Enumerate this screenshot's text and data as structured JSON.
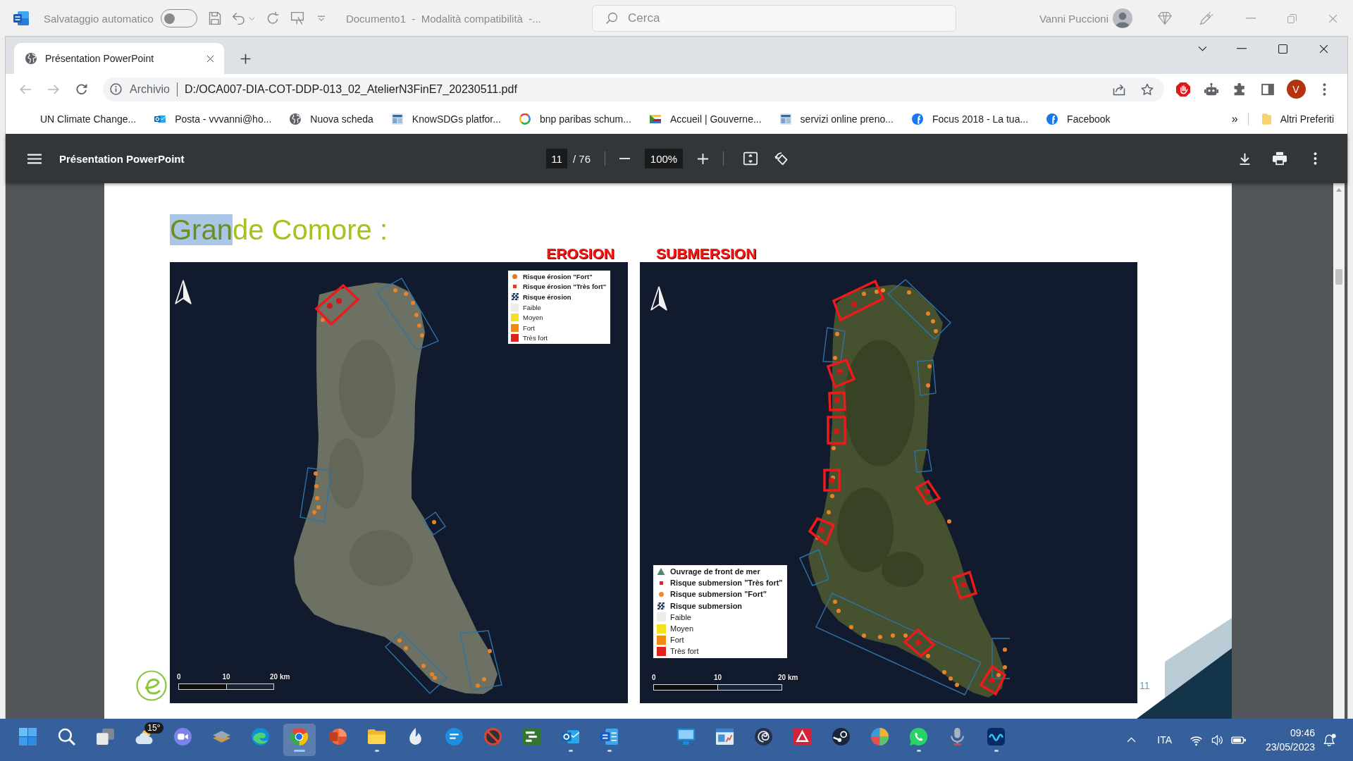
{
  "word_window": {
    "autosave_label": "Salvataggio automatico",
    "autosave_on": false,
    "document_title": "Documento1  -  Modalità compatibilità  -...",
    "search": {
      "placeholder": "Cerca"
    },
    "user_name": "Vanni Puccioni"
  },
  "browser": {
    "tabs": [
      {
        "title": "Présentation PowerPoint",
        "selected": true
      }
    ],
    "address_bar": {
      "scheme": "Archivio",
      "url": "D:/OCA007-DIA-COT-DDP-013_02_AtelierN3FinE7_20230511.pdf"
    },
    "profile_initial": "V",
    "bookmarks": [
      "UN Climate Change...",
      "Posta - vvvanni@ho...",
      "Nuova scheda",
      "KnowSDGs platfor...",
      "bnp paribas schum...",
      "Accueil | Gouverne...",
      "servizi online preno...",
      "Focus 2018 - La tua...",
      "Facebook"
    ],
    "more_bookmarks": "»",
    "other_bookmarks": "Altri Preferiti"
  },
  "pdf_viewer": {
    "title": "Présentation PowerPoint",
    "page": "11",
    "page_total": "/ 76",
    "zoom": "100%"
  },
  "slide": {
    "title": [
      {
        "text": "Gran",
        "highlighted": true
      },
      {
        "text": "de Comore :",
        "highlighted": false
      }
    ],
    "maps": [
      {
        "title": "EROSION",
        "legend": [
          {
            "kind": "dot",
            "label": "Risque érosion \"Fort\"",
            "color": "#e07b25"
          },
          {
            "kind": "small-dot",
            "label": "Risque érosion \"Très fort\"",
            "color": "#d9412a"
          },
          {
            "kind": "raster",
            "label": "Risque érosion"
          },
          {
            "kind": "swatch",
            "label": "Faible",
            "color": "#ececec"
          },
          {
            "kind": "swatch",
            "label": "Moyen",
            "color": "#f5e11b"
          },
          {
            "kind": "swatch",
            "label": "Fort",
            "color": "#f08a10"
          },
          {
            "kind": "swatch",
            "label": "Très fort",
            "color": "#e3211c"
          }
        ],
        "scale": [
          "0",
          "10",
          "20 km"
        ]
      },
      {
        "title": "SUBMERSION",
        "legend": [
          {
            "kind": "triangle",
            "label": "Ouvrage de front de mer",
            "color": "#4f8a64"
          },
          {
            "kind": "small-dot",
            "label": "Risque submersion \"Très fort\"",
            "color": "#e0242a"
          },
          {
            "kind": "dot",
            "label": "Risque submersion \"Fort\"",
            "color": "#f08a24"
          },
          {
            "kind": "raster",
            "label": "Risque submersion"
          },
          {
            "kind": "swatch",
            "label": "Faible",
            "color": "#ececec"
          },
          {
            "kind": "swatch",
            "label": "Moyen",
            "color": "#f5e11b"
          },
          {
            "kind": "swatch",
            "label": "Fort",
            "color": "#f08a10"
          },
          {
            "kind": "swatch",
            "label": "Très fort",
            "color": "#e3211c"
          }
        ],
        "scale": [
          "0",
          "10",
          "20 km"
        ]
      }
    ],
    "page_number": "11"
  },
  "taskbar": {
    "weather": "15°",
    "apps": [
      {
        "running": false,
        "selected": false
      },
      {
        "running": false,
        "selected": false
      },
      {
        "running": false,
        "selected": false
      },
      {
        "running": true,
        "selected": true
      },
      {
        "running": false,
        "selected": false
      },
      {
        "running": true,
        "selected": false
      },
      {
        "running": false,
        "selected": false
      },
      {
        "running": false,
        "selected": false
      },
      {
        "running": false,
        "selected": false
      },
      {
        "running": false,
        "selected": false
      },
      {
        "running": true,
        "selected": false
      },
      {
        "running": true,
        "selected": false
      },
      {
        "running": false,
        "selected": false
      },
      {
        "running": false,
        "selected": false
      },
      {
        "running": false,
        "selected": false
      },
      {
        "running": false,
        "selected": false
      },
      {
        "running": false,
        "selected": false
      },
      {
        "running": false,
        "selected": false
      },
      {
        "running": true,
        "selected": false
      },
      {
        "running": false,
        "selected": false
      },
      {
        "running": true,
        "selected": false
      }
    ],
    "language": "ITA",
    "time": "09:46",
    "date": "23/05/2023"
  }
}
